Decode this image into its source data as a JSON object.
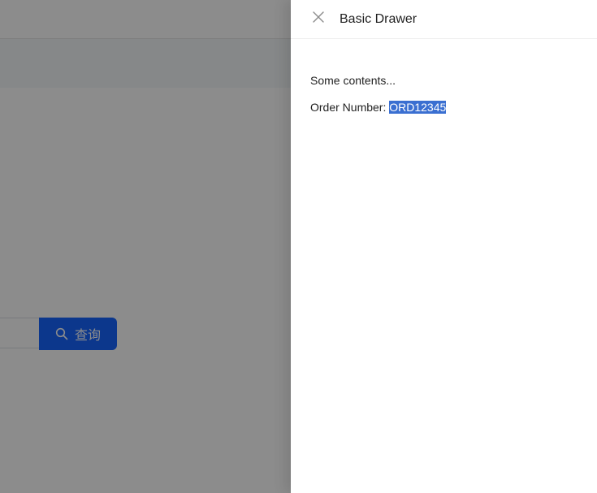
{
  "background_app": {
    "search_button": {
      "label": "查询",
      "icon": "search-icon",
      "color": "#1664ff"
    }
  },
  "drawer": {
    "title": "Basic Drawer",
    "close_icon": "close-icon",
    "content": {
      "line1": "Some contents...",
      "order_label": "Order Number: ",
      "order_number": "ORD12345"
    }
  },
  "colors": {
    "mask": "rgba(0,0,0,0.45)",
    "selection": "#3a6fd1"
  }
}
